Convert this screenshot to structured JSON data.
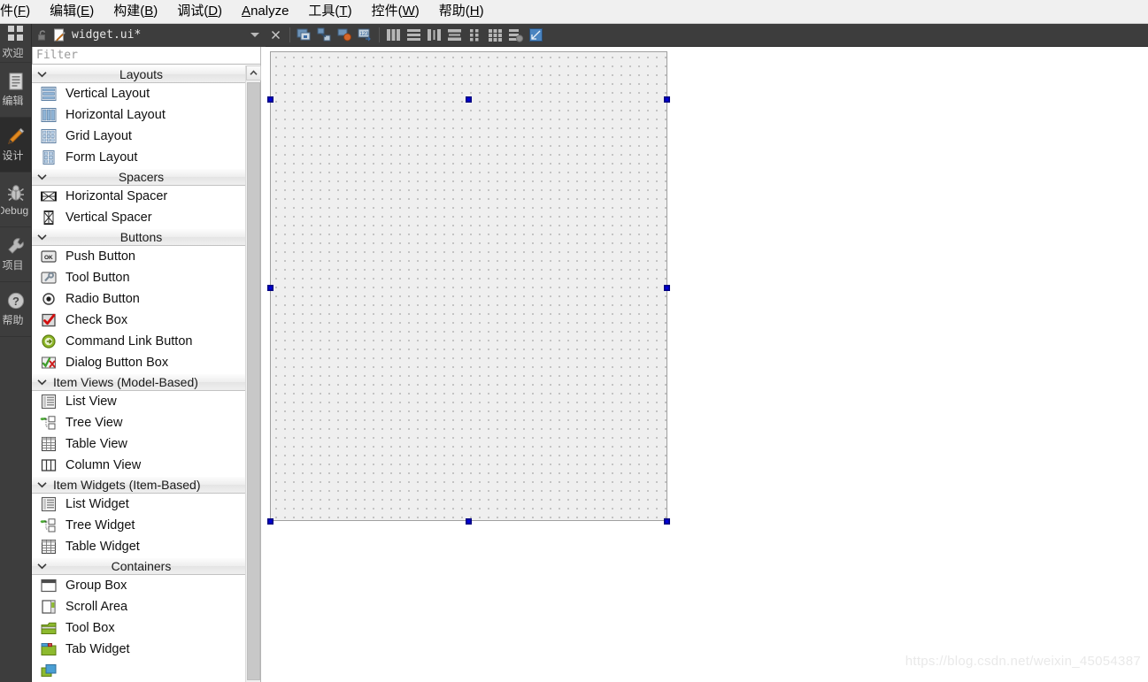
{
  "menubar": {
    "items": [
      {
        "label": "件(F)",
        "mnemonic": "F",
        "prefix": "件(",
        "suffix": ")"
      },
      {
        "label": "编辑(E)",
        "mnemonic": "E",
        "prefix": "编辑(",
        "suffix": ")"
      },
      {
        "label": "构建(B)",
        "mnemonic": "B",
        "prefix": "构建(",
        "suffix": ")"
      },
      {
        "label": "调试(D)",
        "mnemonic": "D",
        "prefix": "调试(",
        "suffix": ")"
      },
      {
        "label": "Analyze",
        "mnemonic": "A",
        "prefix": "",
        "suffix": "nalyze"
      },
      {
        "label": "工具(T)",
        "mnemonic": "T",
        "prefix": "工具(",
        "suffix": ")"
      },
      {
        "label": "控件(W)",
        "mnemonic": "W",
        "prefix": "控件(",
        "suffix": ")"
      },
      {
        "label": "帮助(H)",
        "mnemonic": "H",
        "prefix": "帮助(",
        "suffix": ")"
      }
    ]
  },
  "modebar": {
    "modes": [
      {
        "label": "欢迎",
        "icon": "welcome-grid-icon",
        "active": false
      },
      {
        "label": "编辑",
        "icon": "edit-document-icon",
        "active": false
      },
      {
        "label": "设计",
        "icon": "design-pencil-icon",
        "active": true
      },
      {
        "label": "Debug",
        "icon": "debug-bug-icon",
        "active": false
      },
      {
        "label": "项目",
        "icon": "projects-wrench-icon",
        "active": false
      },
      {
        "label": "帮助",
        "icon": "help-question-icon",
        "active": false
      }
    ]
  },
  "editor_tab": {
    "filename": "widget.ui*",
    "lock_icon": "unlocked-padlock-icon",
    "file_icon": "ui-file-pencil-icon",
    "dropdown_icon": "chevron-down-icon",
    "close_icon": "close-x-icon"
  },
  "form_toolbar": {
    "buttons": [
      {
        "name": "edit-widgets-icon",
        "tooltip": "Edit Widgets"
      },
      {
        "name": "edit-signals-slots-icon",
        "tooltip": "Edit Signals/Slots"
      },
      {
        "name": "edit-buddies-icon",
        "tooltip": "Edit Buddies"
      },
      {
        "name": "edit-tab-order-icon",
        "tooltip": "Edit Tab Order"
      },
      {
        "name": "layout-horizontally-icon",
        "tooltip": "Lay Out Horizontally"
      },
      {
        "name": "layout-vertically-icon",
        "tooltip": "Lay Out Vertically"
      },
      {
        "name": "layout-horizontally-splitter-icon",
        "tooltip": "Lay Out Horizontally in Splitter"
      },
      {
        "name": "layout-vertically-splitter-icon",
        "tooltip": "Lay Out Vertically in Splitter"
      },
      {
        "name": "layout-form-icon",
        "tooltip": "Lay Out in a Form Layout"
      },
      {
        "name": "layout-grid-icon",
        "tooltip": "Lay Out in a Grid"
      },
      {
        "name": "break-layout-icon",
        "tooltip": "Break Layout"
      },
      {
        "name": "adjust-size-icon",
        "tooltip": "Adjust Size"
      }
    ]
  },
  "widgetbox": {
    "filter_placeholder": "Filter",
    "filter_value": "",
    "scroll_up_icon": "chevron-up-icon",
    "sections": [
      {
        "title": "Layouts",
        "expanded": true,
        "centered": true,
        "items": [
          {
            "label": "Vertical Layout",
            "icon": "vertical-layout-icon"
          },
          {
            "label": "Horizontal Layout",
            "icon": "horizontal-layout-icon"
          },
          {
            "label": "Grid Layout",
            "icon": "grid-layout-icon"
          },
          {
            "label": "Form Layout",
            "icon": "form-layout-icon"
          }
        ]
      },
      {
        "title": "Spacers",
        "expanded": true,
        "centered": true,
        "items": [
          {
            "label": "Horizontal Spacer",
            "icon": "horizontal-spacer-icon"
          },
          {
            "label": "Vertical Spacer",
            "icon": "vertical-spacer-icon"
          }
        ]
      },
      {
        "title": "Buttons",
        "expanded": true,
        "centered": true,
        "items": [
          {
            "label": "Push Button",
            "icon": "push-button-icon"
          },
          {
            "label": "Tool Button",
            "icon": "tool-button-icon"
          },
          {
            "label": "Radio Button",
            "icon": "radio-button-icon"
          },
          {
            "label": "Check Box",
            "icon": "check-box-icon"
          },
          {
            "label": "Command Link Button",
            "icon": "command-link-button-icon"
          },
          {
            "label": "Dialog Button Box",
            "icon": "dialog-button-box-icon"
          }
        ]
      },
      {
        "title": "Item Views (Model-Based)",
        "expanded": true,
        "centered": false,
        "items": [
          {
            "label": "List View",
            "icon": "list-view-icon"
          },
          {
            "label": "Tree View",
            "icon": "tree-view-icon"
          },
          {
            "label": "Table View",
            "icon": "table-view-icon"
          },
          {
            "label": "Column View",
            "icon": "column-view-icon"
          }
        ]
      },
      {
        "title": "Item Widgets (Item-Based)",
        "expanded": true,
        "centered": false,
        "items": [
          {
            "label": "List Widget",
            "icon": "list-widget-icon"
          },
          {
            "label": "Tree Widget",
            "icon": "tree-widget-icon"
          },
          {
            "label": "Table Widget",
            "icon": "table-widget-icon"
          }
        ]
      },
      {
        "title": "Containers",
        "expanded": true,
        "centered": true,
        "items": [
          {
            "label": "Group Box",
            "icon": "group-box-icon"
          },
          {
            "label": "Scroll Area",
            "icon": "scroll-area-icon"
          },
          {
            "label": "Tool Box",
            "icon": "tool-box-icon"
          },
          {
            "label": "Tab Widget",
            "icon": "tab-widget-icon"
          },
          {
            "label": "",
            "icon": "stacked-widget-icon"
          }
        ]
      }
    ]
  },
  "form_canvas": {
    "selected": true,
    "handle_count": 8,
    "grid_spacing": 10,
    "background_color": "#efefef",
    "handle_color": "#00009f"
  },
  "watermark": {
    "text": "https://blog.csdn.net/weixin_45054387"
  }
}
